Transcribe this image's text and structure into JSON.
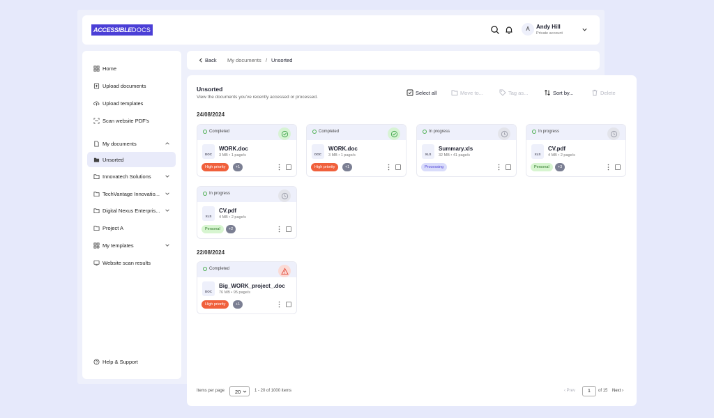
{
  "app": {
    "logo_part1": "ACCESSIBLE",
    "logo_part2": "DOCS"
  },
  "user": {
    "initial": "A",
    "name": "Andy Hill",
    "role": "Private account"
  },
  "sidebar": {
    "items": [
      {
        "label": "Home",
        "icon": "home-grid-icon"
      },
      {
        "label": "Upload documents",
        "icon": "upload-file-icon"
      },
      {
        "label": "Upload templates",
        "icon": "cloud-upload-icon"
      },
      {
        "label": "Scan website PDF's",
        "icon": "scan-icon"
      },
      {
        "label": "My documents",
        "icon": "document-icon"
      },
      {
        "label": "Unsorted",
        "icon": "folder-icon",
        "active": true
      },
      {
        "label": "Innovatech Solutions",
        "icon": "folder-icon"
      },
      {
        "label": "TechVantage Innovatio...",
        "icon": "folder-icon"
      },
      {
        "label": "Digital Nexus Enterpris...",
        "icon": "folder-icon"
      },
      {
        "label": "Project A",
        "icon": "folder-icon"
      },
      {
        "label": "My templates",
        "icon": "template-grid-icon"
      },
      {
        "label": "Website scan results",
        "icon": "monitor-icon"
      }
    ],
    "help": "Help & Support"
  },
  "breadcrumb": {
    "back": "Back",
    "parent": "My documents",
    "separator": "/",
    "current": "Unsorted"
  },
  "main": {
    "title": "Unsorted",
    "subtitle": "View the documents you've recently accessed or processed.",
    "toolbar": {
      "select_all": "Select all",
      "move_to": "Move to...",
      "tag_as": "Tag as...",
      "sort_by": "Sort by...",
      "delete": "Delete"
    },
    "groups": [
      {
        "date": "24/08/2024",
        "cards": [
          {
            "status": "Completed",
            "name": "WORK.doc",
            "meta": "3 MB • 1 page/s",
            "type": "DOC",
            "tag": "High priority",
            "more": "+1"
          },
          {
            "status": "Completed",
            "name": "WORK.doc",
            "meta": "3 MB • 1 page/s",
            "type": "DOC",
            "tag": "High priority",
            "more": "+1"
          },
          {
            "status": "In progress",
            "name": "Summary.xls",
            "meta": "32 MB • 41 page/s",
            "type": "XLS",
            "tag": "Processing",
            "more": ""
          },
          {
            "status": "In progress",
            "name": "CV.pdf",
            "meta": "4 MB • 2 page/s",
            "type": "XLS",
            "tag": "Personal",
            "more": "+3"
          },
          {
            "status": "In progress",
            "name": "CV.pdf",
            "meta": "4 MB • 2 page/s",
            "type": "XLS",
            "tag": "Personal",
            "more": "+2"
          }
        ]
      },
      {
        "date": "22/08/2024",
        "cards": [
          {
            "status": "Completed",
            "name": "Big_WORK_project_.doc",
            "meta": "76 MB • 95 page/s",
            "type": "DOC",
            "tag": "High priority",
            "more": "+1"
          }
        ]
      }
    ]
  },
  "pagination": {
    "items_label": "Items per page",
    "per_page": "20",
    "range": "1 - 20 of 1000 items",
    "prev": "Prev",
    "page": "1",
    "of": "of 15",
    "next": "Next"
  },
  "colors": {
    "brand": "#4b3fd6",
    "completed": "#4caf50",
    "in_progress": "#9a9ca8",
    "warning": "#e24a3b",
    "tag_high": "#f0603c",
    "tag_processing": "#d9dcfb",
    "tag_personal": "#d7f5d0"
  }
}
